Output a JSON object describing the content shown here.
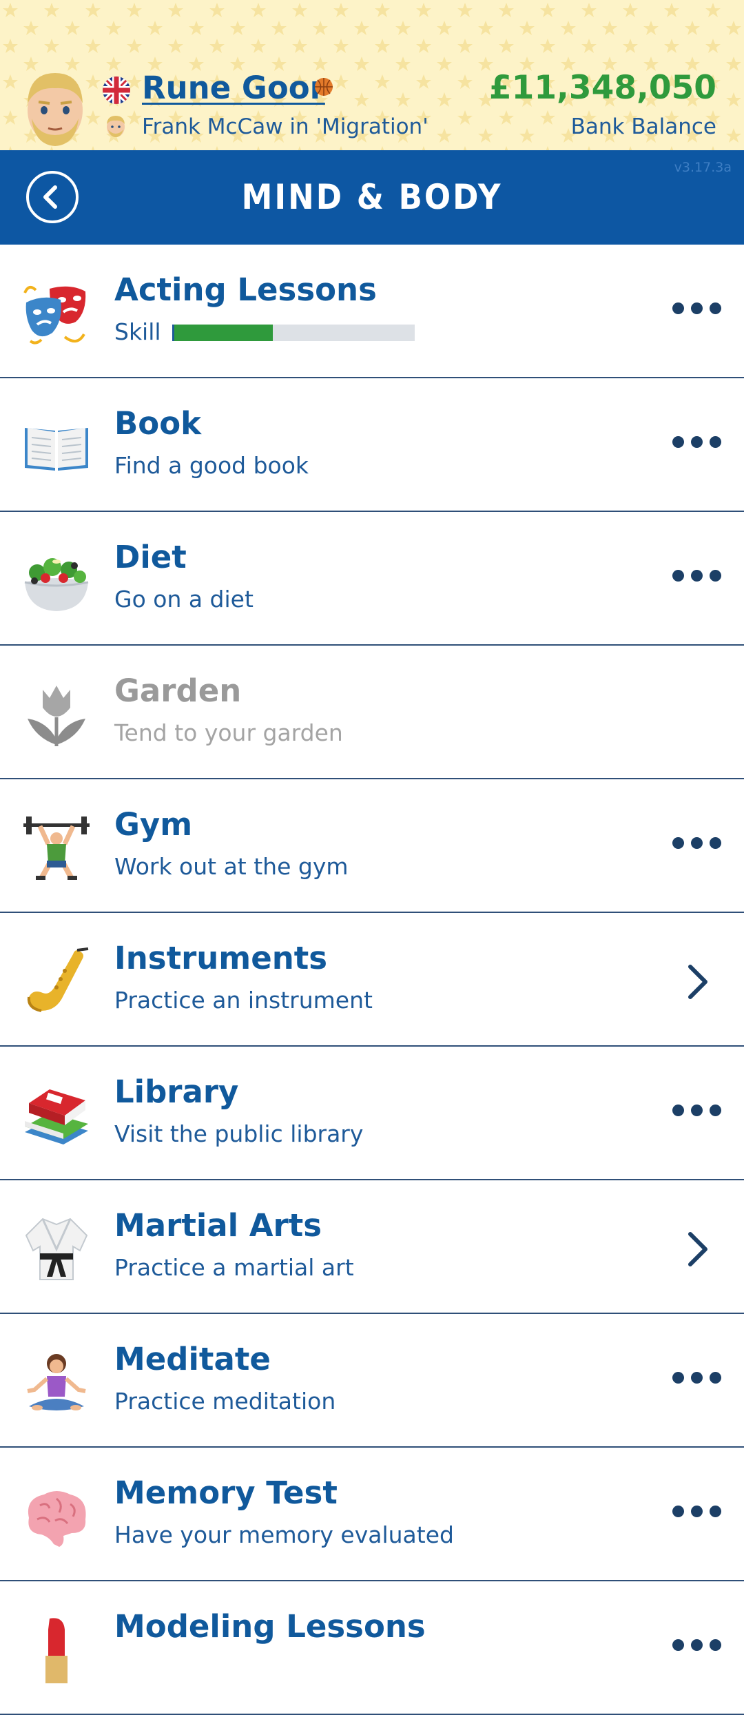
{
  "header": {
    "player_name": "Rune Goor",
    "subline": "Frank McCaw in 'Migration'",
    "bank_amount": "£11,348,050",
    "bank_label": "Bank Balance",
    "flag_icon": "uk-flag-icon",
    "sport_icon": "basketball-icon"
  },
  "titlebar": {
    "title": "Mind & Body",
    "version": "v3.17.3a",
    "back_icon": "back-arrow-icon"
  },
  "colors": {
    "accent": "#0d57a3",
    "money": "#2f9a3c",
    "text_blue": "#10599c",
    "disabled": "#9a9a9a"
  },
  "activities": [
    {
      "name": "Acting Lessons",
      "skill_label": "Skill",
      "skill_level": 0.41,
      "icon": "theater-masks-icon",
      "action": "more"
    },
    {
      "name": "Book",
      "desc": "Find a good book",
      "icon": "open-book-icon",
      "action": "more"
    },
    {
      "name": "Diet",
      "desc": "Go on a diet",
      "icon": "salad-icon",
      "action": "more"
    },
    {
      "name": "Garden",
      "desc": "Tend to your garden",
      "icon": "tulip-icon",
      "action": "none",
      "disabled": true
    },
    {
      "name": "Gym",
      "desc": "Work out at the gym",
      "icon": "weightlifter-icon",
      "action": "more"
    },
    {
      "name": "Instruments",
      "desc": "Practice an instrument",
      "icon": "saxophone-icon",
      "action": "chevron"
    },
    {
      "name": "Library",
      "desc": "Visit the public library",
      "icon": "books-icon",
      "action": "more"
    },
    {
      "name": "Martial Arts",
      "desc": "Practice a martial art",
      "icon": "martial-arts-uniform-icon",
      "action": "chevron"
    },
    {
      "name": "Meditate",
      "desc": "Practice meditation",
      "icon": "meditation-icon",
      "action": "more"
    },
    {
      "name": "Memory Test",
      "desc": "Have your memory evaluated",
      "icon": "brain-icon",
      "action": "more"
    },
    {
      "name": "Modeling Lessons",
      "desc": "",
      "icon": "lipstick-icon",
      "action": "more"
    }
  ]
}
